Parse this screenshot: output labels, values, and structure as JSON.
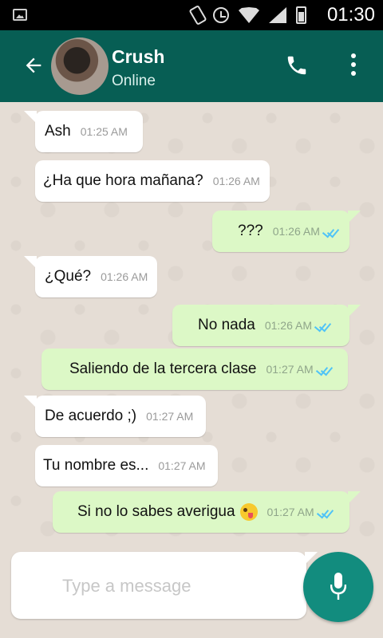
{
  "status_bar": {
    "time": "01:30"
  },
  "header": {
    "name": "Crush",
    "status": "Online"
  },
  "messages": [
    {
      "direction": "in",
      "text": "Ash",
      "time": "01:25 AM"
    },
    {
      "direction": "in",
      "text": "¿Ha que hora mañana?",
      "time": "01:26 AM"
    },
    {
      "direction": "out",
      "text": "???",
      "time": "01:26 AM"
    },
    {
      "direction": "in",
      "text": "¿Qué?",
      "time": "01:26 AM"
    },
    {
      "direction": "out",
      "text": "No nada",
      "time": "01:26 AM"
    },
    {
      "direction": "out",
      "text": "Saliendo de la tercera clase",
      "time": "01:27 AM"
    },
    {
      "direction": "in",
      "text": "De acuerdo ;)",
      "time": "01:27 AM"
    },
    {
      "direction": "in",
      "text": "Tu nombre es...",
      "time": "01:27 AM"
    },
    {
      "direction": "out",
      "text": "Si no lo sabes averigua",
      "time": "01:27 AM",
      "emoji": "winking-tongue-emoji"
    }
  ],
  "composer": {
    "placeholder": "Type a message"
  },
  "colors": {
    "header": "#075e54",
    "outgoing": "#dcf8c6",
    "incoming": "#ffffff",
    "mic": "#128c7e",
    "ticks": "#4fc3f7"
  }
}
